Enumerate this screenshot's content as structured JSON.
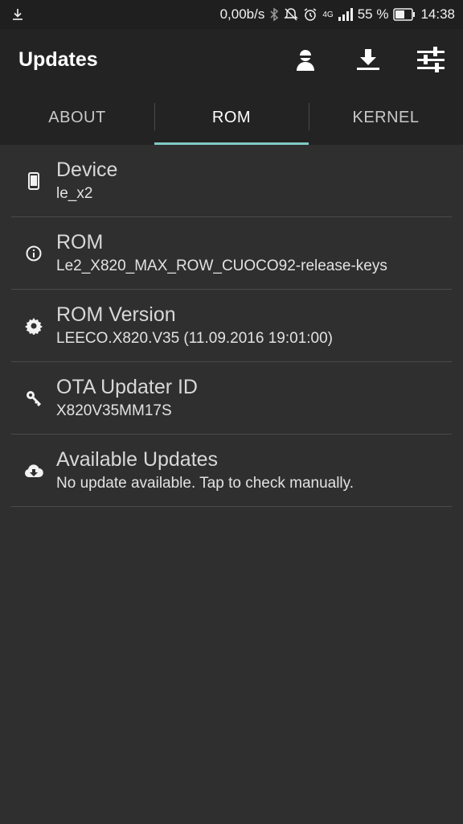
{
  "status_bar": {
    "net_speed": "0,00b/s",
    "network": "4G",
    "battery_percent": "55 %",
    "time": "14:38"
  },
  "app_bar": {
    "title": "Updates",
    "actions": [
      {
        "name": "account-icon"
      },
      {
        "name": "download-icon"
      },
      {
        "name": "settings-sliders-icon"
      }
    ]
  },
  "tabs": [
    {
      "label": "ABOUT",
      "active": false
    },
    {
      "label": "ROM",
      "active": true
    },
    {
      "label": "KERNEL",
      "active": false
    }
  ],
  "rows": [
    {
      "icon": "phone-icon",
      "title": "Device",
      "subtitle": "le_x2"
    },
    {
      "icon": "info-icon",
      "title": "ROM",
      "subtitle": "Le2_X820_MAX_ROW_CUOCO92-release-keys"
    },
    {
      "icon": "gear-icon",
      "title": "ROM Version",
      "subtitle": "LEECO.X820.V35 (11.09.2016 19:01:00)"
    },
    {
      "icon": "key-icon",
      "title": "OTA Updater ID",
      "subtitle": "X820V35MM17S"
    },
    {
      "icon": "cloud-download-icon",
      "title": "Available Updates",
      "subtitle": "No update available. Tap to check manually."
    }
  ],
  "colors": {
    "accent": "#80cbc4",
    "background": "#2f2f2f",
    "toolbar": "#232323"
  }
}
